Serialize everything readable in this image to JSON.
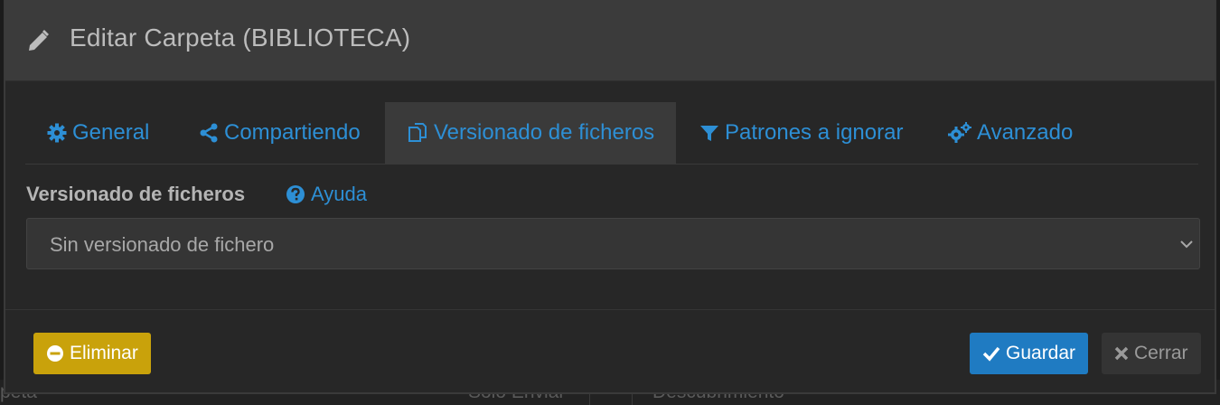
{
  "background": {
    "texts": [
      "peta",
      "Sólo Enviar",
      "Descubrimiento"
    ]
  },
  "dialog": {
    "title": "Editar Carpeta (BIBLIOTECA)",
    "title_icon": "pencil-icon"
  },
  "tabs": [
    {
      "label": "General",
      "icon": "cog-icon",
      "active": false
    },
    {
      "label": "Compartiendo",
      "icon": "share-icon",
      "active": false
    },
    {
      "label": "Versionado de ficheros",
      "icon": "copy-icon",
      "active": true
    },
    {
      "label": "Patrones a ignorar",
      "icon": "filter-icon",
      "active": false
    },
    {
      "label": "Avanzado",
      "icon": "cogs-icon",
      "active": false
    }
  ],
  "versioning": {
    "label": "Versionado de ficheros",
    "help_label": "Ayuda",
    "select_value": "Sin versionado de fichero"
  },
  "footer": {
    "delete_label": "Eliminar",
    "save_label": "Guardar",
    "close_label": "Cerrar"
  },
  "colors": {
    "accent": "#2d8fd5",
    "danger": "#c9a20b",
    "primary": "#1f7bc2"
  }
}
